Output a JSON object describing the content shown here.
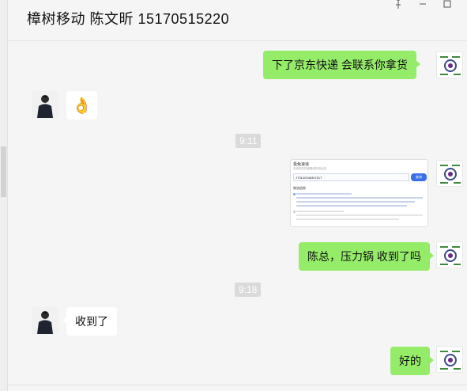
{
  "window": {
    "title": "樟树移动 陈文昕  15170515220"
  },
  "screenshot_preview": {
    "title": "极兔速递",
    "input_value": "JT3120346397017",
    "button_label": "查询",
    "section_label": "物流追踪"
  },
  "messages": [
    {
      "side": "right",
      "type": "text",
      "text": "下了京东快递     会联系你拿货"
    },
    {
      "side": "left",
      "type": "sticker",
      "emoji": "👌"
    },
    {
      "side": "center",
      "type": "time",
      "text": "9:11"
    },
    {
      "side": "right",
      "type": "image",
      "alt": "极兔速递查询截图"
    },
    {
      "side": "right",
      "type": "text",
      "text": "陈总，压力锅 收到了吗"
    },
    {
      "side": "center",
      "type": "time",
      "text": "9:18"
    },
    {
      "side": "left",
      "type": "text",
      "text": "收到了"
    },
    {
      "side": "right",
      "type": "text",
      "text": "好的"
    }
  ],
  "colors": {
    "bubble_self": "#95ec69",
    "bubble_other": "#ffffff",
    "background": "#f5f5f5",
    "time_chip": "#dadada"
  }
}
